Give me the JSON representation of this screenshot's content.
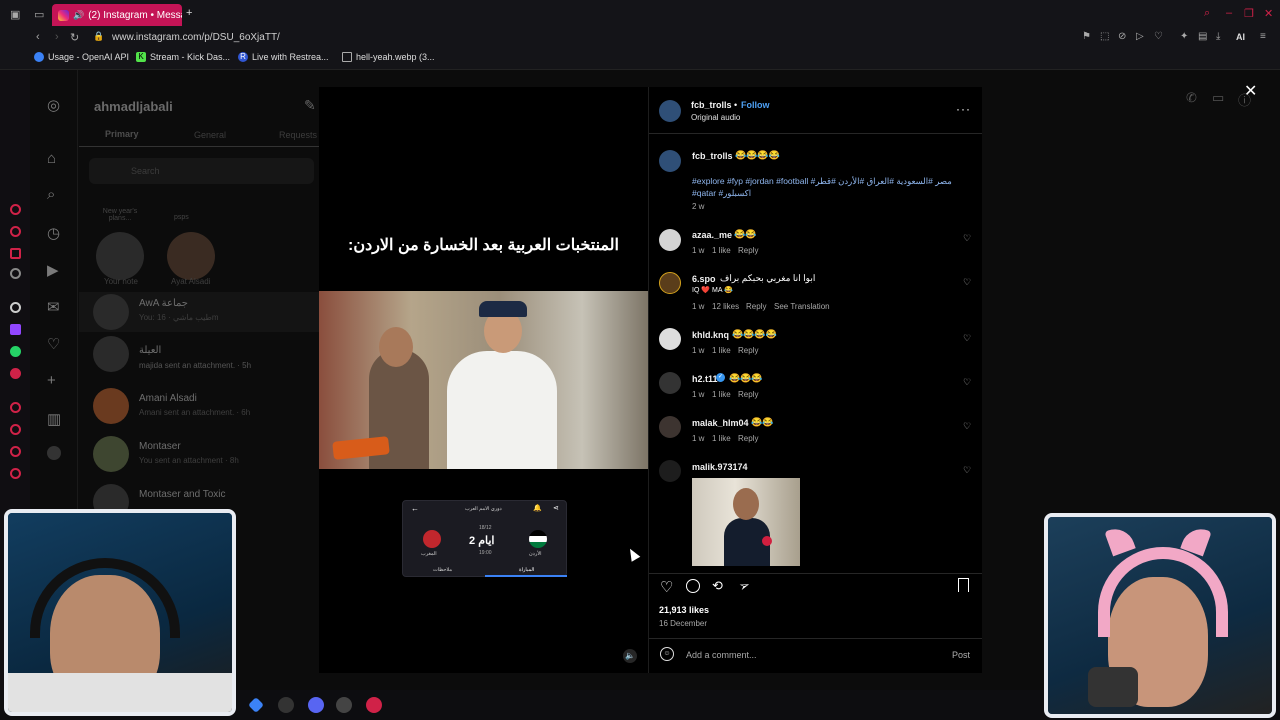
{
  "browser": {
    "tab_title": "(2) Instagram • Messa",
    "new_tab_icon": "plus-icon",
    "url": "www.instagram.com/p/DSU_6oXjaTT/",
    "ai_label": "AI",
    "bookmarks": [
      "Usage - OpenAI API",
      "Stream - Kick Das...",
      "Live with Restrea...",
      "hell-yeah.webp (3..."
    ],
    "accent_color": "#c41456"
  },
  "dm": {
    "username": "ahmadljabali",
    "tabs": [
      "Primary",
      "General",
      "Requests"
    ],
    "search_placeholder": "Search",
    "notes": [
      {
        "bubble": "New year's plans...",
        "label": "Your note"
      },
      {
        "bubble": "psps",
        "label": "Ayat Alsadi"
      }
    ],
    "threads": [
      {
        "name": "AwA جماعة",
        "preview": "You: طيب ماشي · 16m"
      },
      {
        "name": "العيلة",
        "preview": "majida sent an attachment. · 5h"
      },
      {
        "name": "Amani Alsadi",
        "preview": "Amani sent an attachment. · 6h"
      },
      {
        "name": "Montaser",
        "preview": "You sent an attachment · 8h"
      },
      {
        "name": "Montaser and Toxic",
        "preview": ""
      }
    ]
  },
  "post": {
    "author": "fcb_trolls",
    "follow_label": "Follow",
    "audio": "Original audio",
    "video_caption": "المنتخبات العربية بعد الخسارة من الاردن:",
    "inset": {
      "header": "دوري الامم العرب",
      "time": "19:00",
      "countdown": "2 ايام",
      "date": "18/12",
      "team_left": "المغرب",
      "team_right": "الأردن",
      "tab_left": "ملاحظات",
      "tab_right": "المباراة"
    },
    "caption_user": "fcb_trolls",
    "caption_emoji": "😂😂😂😂",
    "caption_tags": "#explore #fyp #jordan #football #مصر #السعودية #العراق #الأردن #قطر #qatar #اكسبلور",
    "caption_time": "2 w",
    "comments": [
      {
        "user": "azaa._me",
        "text": "😂😂",
        "meta": [
          "1 w",
          "1 like",
          "Reply"
        ]
      },
      {
        "user": "6.spo",
        "text": "ابوا انا مغربي بحبكم براف",
        "text2": "IQ ❤️ MA 😂",
        "meta": [
          "1 w",
          "12 likes",
          "Reply",
          "See Translation"
        ]
      },
      {
        "user": "khld.knq",
        "text": "😂😂😂😂",
        "meta": [
          "1 w",
          "1 like",
          "Reply"
        ]
      },
      {
        "user": "h2.t11",
        "text": "😂😂😂",
        "meta": [
          "1 w",
          "1 like",
          "Reply"
        ]
      },
      {
        "user": "malak_hlm04",
        "text": "😂😂",
        "meta": [
          "1 w",
          "1 like",
          "Reply"
        ]
      },
      {
        "user": "malik.973174",
        "text": "",
        "meta": []
      }
    ],
    "likes": "21,913 likes",
    "date": "16 December",
    "add_comment_placeholder": "Add a comment...",
    "post_label": "Post",
    "more_icon": "more-horizontal-icon",
    "close_icon": "close-icon"
  }
}
